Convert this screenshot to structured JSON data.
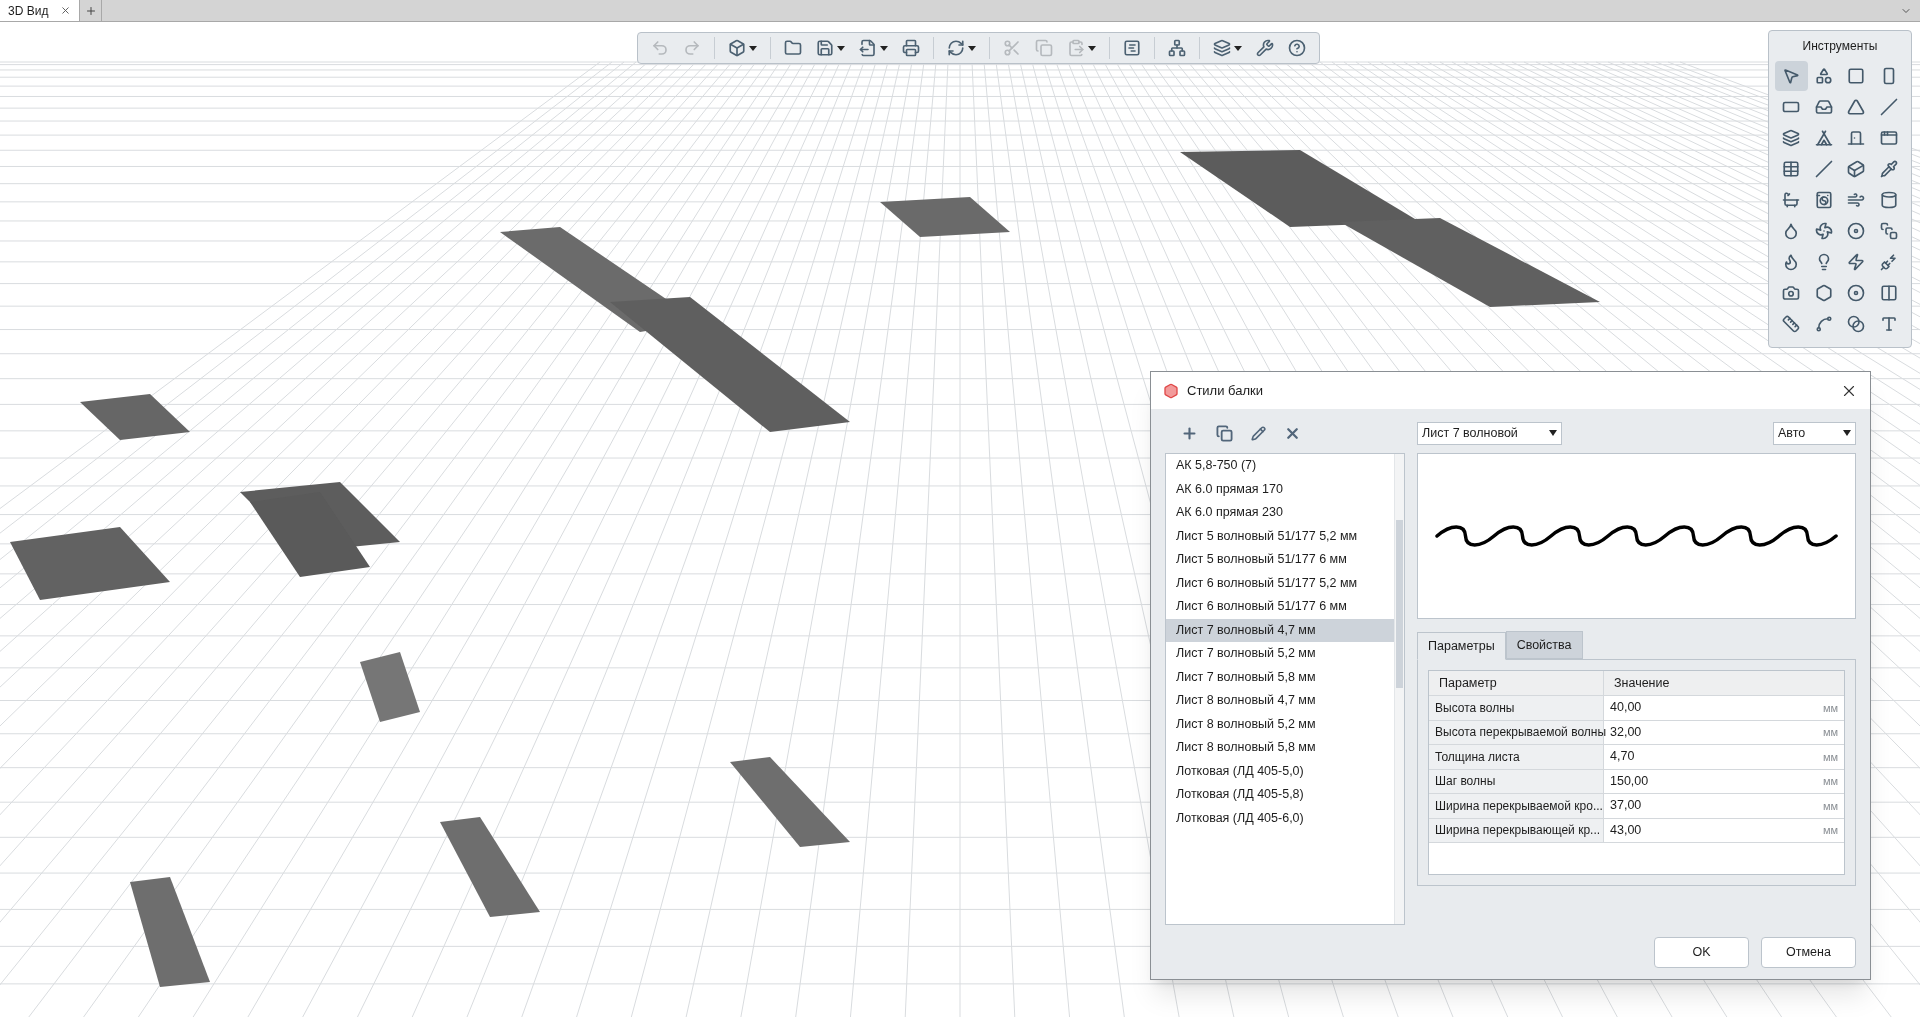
{
  "document_tabs": [
    {
      "label": "3D Вид",
      "selected": true
    }
  ],
  "toolbar": [
    {
      "kind": "undo",
      "disabled": true,
      "dropdown": false
    },
    {
      "kind": "redo",
      "disabled": true,
      "dropdown": false
    },
    {
      "kind": "view3d",
      "disabled": false,
      "dropdown": true
    },
    {
      "kind": "open",
      "disabled": false,
      "dropdown": false
    },
    {
      "kind": "save",
      "disabled": false,
      "dropdown": true
    },
    {
      "kind": "export",
      "disabled": false,
      "dropdown": true
    },
    {
      "kind": "print",
      "disabled": false,
      "dropdown": false
    },
    {
      "kind": "sync",
      "disabled": false,
      "dropdown": true
    },
    {
      "kind": "cut",
      "disabled": true,
      "dropdown": false
    },
    {
      "kind": "copy",
      "disabled": true,
      "dropdown": false
    },
    {
      "kind": "paste",
      "disabled": true,
      "dropdown": true
    },
    {
      "kind": "text",
      "disabled": false,
      "dropdown": false
    },
    {
      "kind": "tree",
      "disabled": false,
      "dropdown": false
    },
    {
      "kind": "layers",
      "disabled": false,
      "dropdown": true
    },
    {
      "kind": "settings",
      "disabled": false,
      "dropdown": false
    },
    {
      "kind": "help",
      "disabled": false,
      "dropdown": false
    }
  ],
  "tools_panel": {
    "title": "Инструменты",
    "tools": [
      {
        "selected": true
      },
      {
        "selected": false
      },
      {
        "selected": false
      },
      {
        "selected": false
      },
      {
        "selected": false
      },
      {
        "selected": false
      },
      {
        "selected": false
      },
      {
        "selected": false
      },
      {
        "selected": false
      },
      {
        "selected": false
      },
      {
        "selected": false
      },
      {
        "selected": false
      },
      {
        "selected": false
      },
      {
        "selected": false
      },
      {
        "selected": false
      },
      {
        "selected": false
      },
      {
        "selected": false
      },
      {
        "selected": false
      },
      {
        "selected": false
      },
      {
        "selected": false
      },
      {
        "selected": false
      },
      {
        "selected": false
      },
      {
        "selected": false
      },
      {
        "selected": false
      },
      {
        "selected": false
      },
      {
        "selected": false
      },
      {
        "selected": false
      },
      {
        "selected": false
      },
      {
        "selected": false
      },
      {
        "selected": false
      },
      {
        "selected": false
      },
      {
        "selected": false
      },
      {
        "selected": false
      },
      {
        "selected": false
      },
      {
        "selected": false
      },
      {
        "selected": false
      }
    ]
  },
  "dialog": {
    "title": "Стили балки",
    "styles": [
      {
        "label": "АК 5,8-750 (7)",
        "selected": false
      },
      {
        "label": "АК 6.0 прямая 170",
        "selected": false
      },
      {
        "label": "АК 6.0 прямая 230",
        "selected": false
      },
      {
        "label": "Лист 5 волновый 51/177 5,2 мм",
        "selected": false
      },
      {
        "label": "Лист 5 волновый 51/177 6 мм",
        "selected": false
      },
      {
        "label": "Лист 6 волновый 51/177 5,2 мм",
        "selected": false
      },
      {
        "label": "Лист 6 волновый 51/177 6 мм",
        "selected": false
      },
      {
        "label": "Лист 7 волновый 4,7 мм",
        "selected": true
      },
      {
        "label": "Лист 7 волновый 5,2 мм",
        "selected": false
      },
      {
        "label": "Лист 7 волновый 5,8 мм",
        "selected": false
      },
      {
        "label": "Лист 8 волновый 4,7 мм",
        "selected": false
      },
      {
        "label": "Лист 8 волновый 5,2 мм",
        "selected": false
      },
      {
        "label": "Лист 8 волновый 5,8 мм",
        "selected": false
      },
      {
        "label": "Лотковая (ЛД 405-5,0)",
        "selected": false
      },
      {
        "label": "Лотковая (ЛД 405-5,8)",
        "selected": false
      },
      {
        "label": "Лотковая (ЛД 405-6,0)",
        "selected": false
      }
    ],
    "profile_select": "Лист 7 волновой",
    "scale_select": "Авто",
    "tabs": [
      {
        "label": "Параметры",
        "selected": true
      },
      {
        "label": "Свойства",
        "selected": false
      }
    ],
    "table": {
      "columns": [
        "Параметр",
        "Значение"
      ],
      "rows": [
        {
          "name": "Высота волны",
          "value": "40,00",
          "unit": "мм"
        },
        {
          "name": "Высота перекрываемой волны",
          "value": "32,00",
          "unit": "мм"
        },
        {
          "name": "Толщина листа",
          "value": "4,70",
          "unit": "мм"
        },
        {
          "name": "Шаг волны",
          "value": "150,00",
          "unit": "мм"
        },
        {
          "name": "Ширина перекрываемой кро...",
          "value": "37,00",
          "unit": "мм"
        },
        {
          "name": "Ширина перекрывающей кр...",
          "value": "43,00",
          "unit": "мм"
        }
      ]
    },
    "buttons": [
      "OK",
      "Отмена"
    ]
  }
}
